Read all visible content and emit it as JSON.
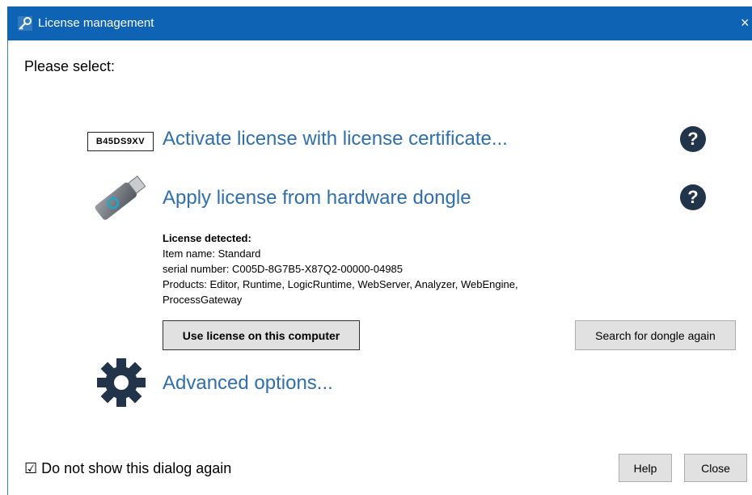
{
  "window": {
    "title": "License management",
    "close_glyph": "×"
  },
  "prompt": "Please select:",
  "options": {
    "certificate": {
      "label": "Activate license with license certificate...",
      "badge": "B45DS9XV",
      "help": "?"
    },
    "dongle": {
      "label": "Apply license from hardware dongle",
      "help": "?"
    },
    "advanced": {
      "label": "Advanced options..."
    }
  },
  "license_info": {
    "heading": "License detected:",
    "item_name": "Item name: Standard",
    "serial": "serial number: C005D-8G7B5-X87Q2-00000-04985",
    "products": "Products: Editor, Runtime, LogicRuntime, WebServer, Analyzer, WebEngine,",
    "products_cont": "ProcessGateway"
  },
  "buttons": {
    "use_license": "Use license on this computer",
    "search_dongle": "Search for dongle again",
    "help": "Help",
    "close": "Close"
  },
  "footer": {
    "checkbox_mark": "☑",
    "checkbox_label": "Do not show this dialog again"
  },
  "colors": {
    "titlebar": "#0e63b4",
    "link": "#2f6fb0",
    "help_icon": "#22344a",
    "button_bg": "#e1e1e1"
  },
  "icons": [
    "key-icon",
    "certificate-badge-icon",
    "usb-dongle-icon",
    "gear-icon",
    "question-icon"
  ]
}
